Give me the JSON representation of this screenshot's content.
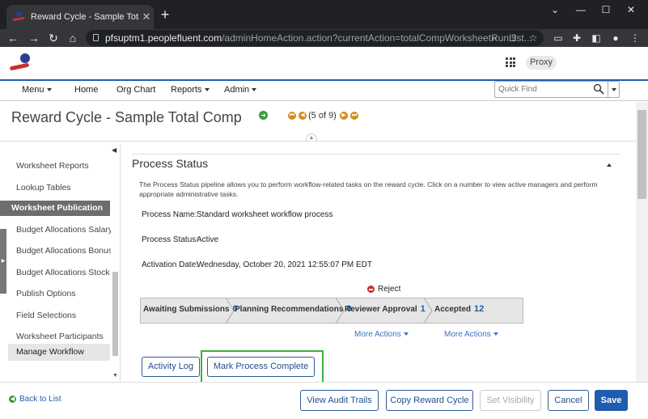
{
  "browser": {
    "tab_title": "Reward Cycle - Sample Total Com",
    "url_host": "pfsuptm1.peoplefluent.com",
    "url_path": "/adminHomeAction.action?currentAction=totalCompWorksheetRunList..."
  },
  "header": {
    "proxy_label": "Proxy"
  },
  "nav": {
    "menu": "Menu",
    "home": "Home",
    "org_chart": "Org Chart",
    "reports": "Reports",
    "admin": "Admin",
    "quick_find_placeholder": "Quick Find"
  },
  "page": {
    "title": "Reward Cycle - Sample Total Comp",
    "pager": "(5 of 9)"
  },
  "sidebar": {
    "items": [
      {
        "label": "Worksheet Reports"
      },
      {
        "label": "Lookup Tables"
      }
    ],
    "section": "Worksheet Publication",
    "sub_items": [
      {
        "label": "Budget Allocations Salary"
      },
      {
        "label": "Budget Allocations Bonus"
      },
      {
        "label": "Budget Allocations Stock"
      },
      {
        "label": "Publish Options"
      },
      {
        "label": "Field Selections"
      },
      {
        "label": "Worksheet Participants"
      }
    ],
    "active": "Manage Workflow"
  },
  "process_status": {
    "title": "Process Status",
    "description": "The Process Status pipeline allows you to perform workflow-related tasks on the reward cycle. Click on a number to view active managers and perform appropriate administrative tasks.",
    "name_label": "Process Name:",
    "name_value": "Standard worksheet workflow process",
    "status_label": "Process Status:",
    "status_value": "Active",
    "activation_label": "Activation Date:",
    "activation_value": "Wednesday, October 20, 2021 12:55:07 PM EDT",
    "reject_label": "Reject",
    "stages": [
      {
        "label": "Awaiting Submissions",
        "count": "0"
      },
      {
        "label": "Planning Recommendations",
        "count": "0"
      },
      {
        "label": "Reviewer Approval",
        "count": "1"
      },
      {
        "label": "Accepted",
        "count": "12"
      }
    ],
    "more_actions_1": "More Actions",
    "more_actions_2": "More Actions",
    "activity_log": "Activity Log",
    "mark_complete": "Mark Process Complete"
  },
  "footer": {
    "back_to_list": "Back to List",
    "view_audit_trails": "View Audit Trails",
    "copy_reward_cycle": "Copy Reward Cycle",
    "set_visibility": "Set Visibility",
    "cancel": "Cancel",
    "save": "Save"
  },
  "colors": {
    "brand_blue": "#1f5cae",
    "highlight_green": "#3fb03f",
    "reject_red": "#c8302e",
    "pager_orange": "#d68a1a"
  }
}
